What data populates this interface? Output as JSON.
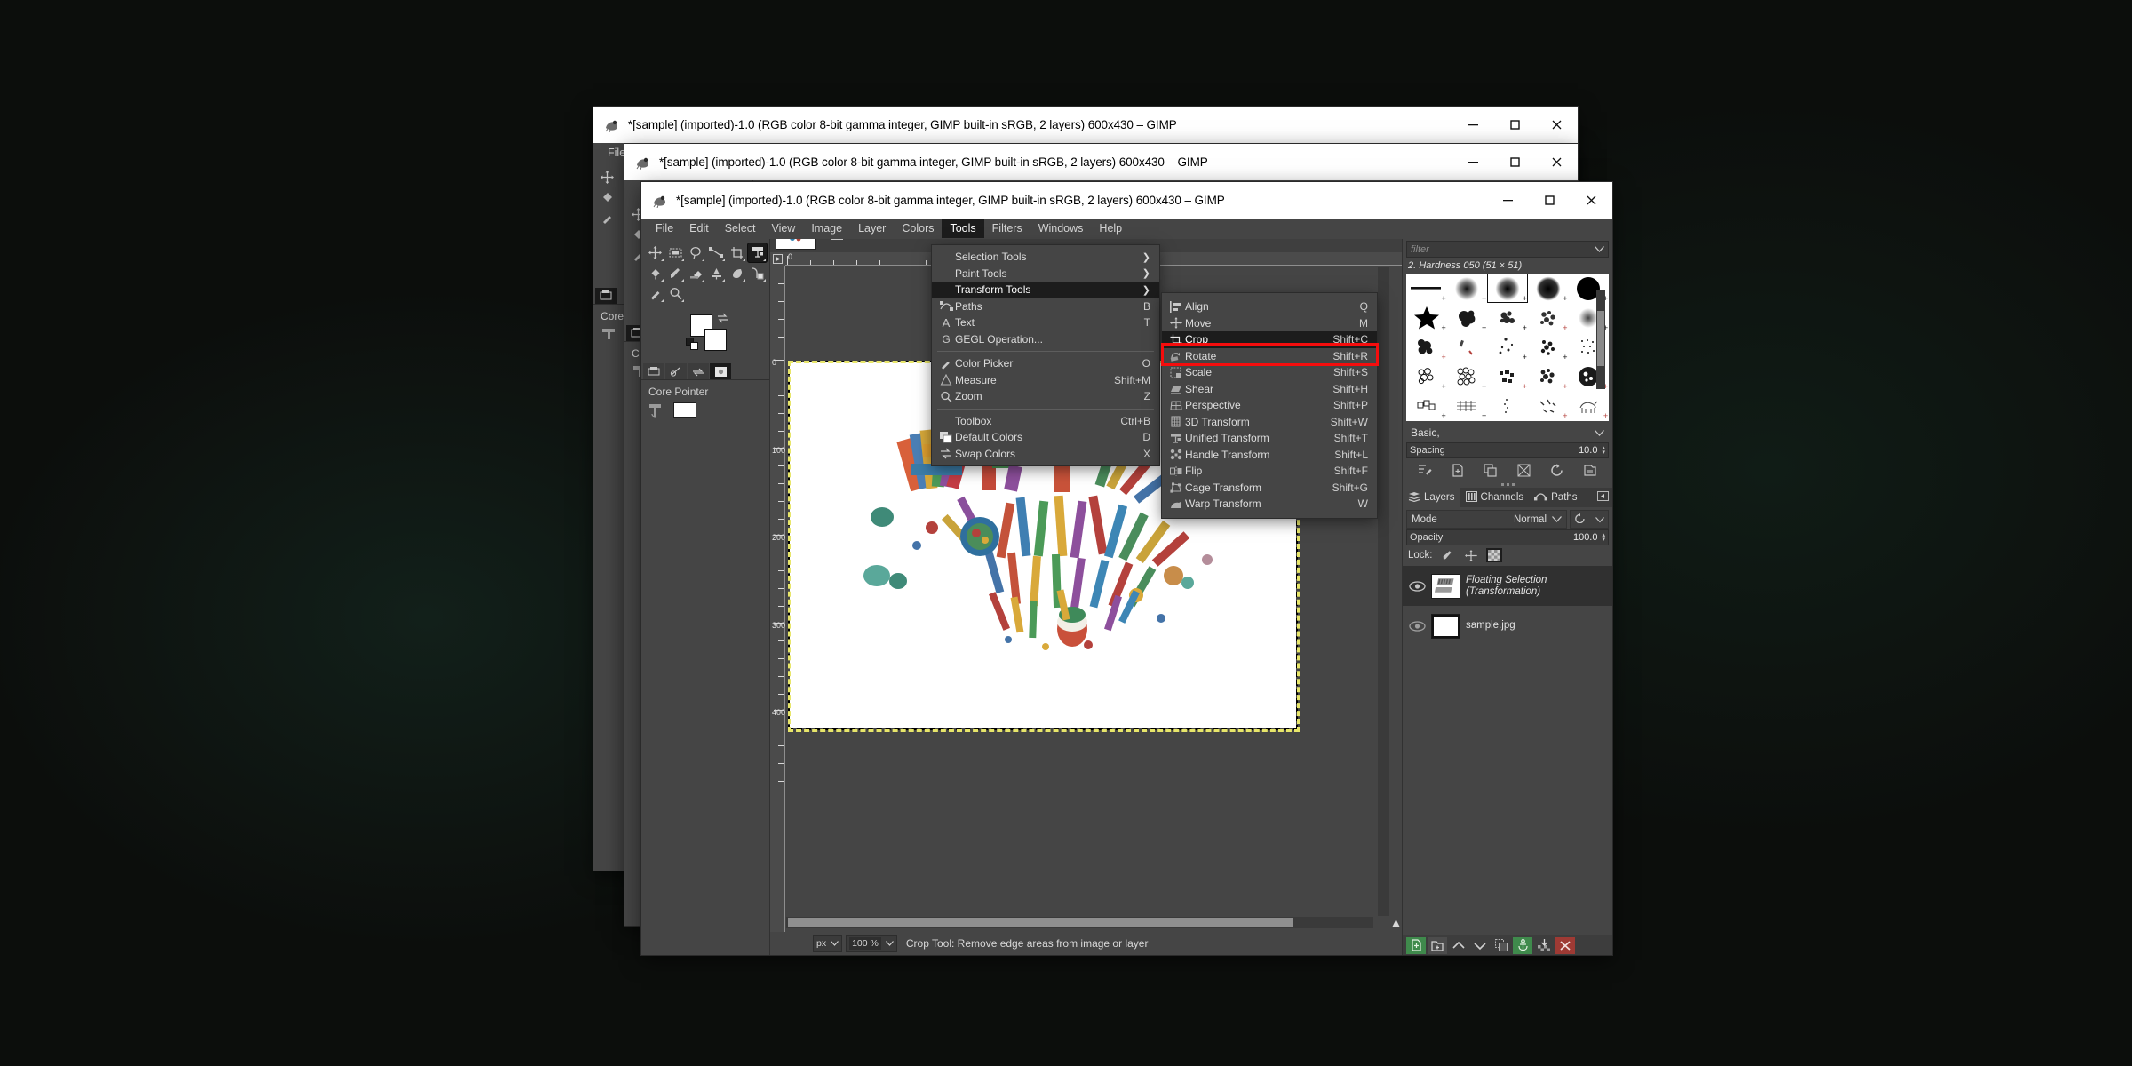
{
  "app": {
    "title": "*[sample] (imported)-1.0 (RGB color 8-bit gamma integer, GIMP built-in sRGB, 2 layers) 600x430 – GIMP",
    "window_count": 3,
    "accent_highlight": "#f50d0d",
    "desktop_bg": "#0c0e0c"
  },
  "titlebar": {
    "minimize": "–",
    "maximize": "□",
    "close": "✕",
    "icon": "gimp-wilber-icon"
  },
  "menubar": {
    "items": [
      {
        "label": "File",
        "active": false
      },
      {
        "label": "Edit",
        "active": false
      },
      {
        "label": "Select",
        "active": false
      },
      {
        "label": "View",
        "active": false
      },
      {
        "label": "Image",
        "active": false
      },
      {
        "label": "Layer",
        "active": false
      },
      {
        "label": "Colors",
        "active": false
      },
      {
        "label": "Tools",
        "active": true
      },
      {
        "label": "Filters",
        "active": false
      },
      {
        "label": "Windows",
        "active": false
      },
      {
        "label": "Help",
        "active": false
      }
    ]
  },
  "tools_menu": {
    "items": [
      {
        "label": "Selection Tools",
        "accel": "",
        "submenu": true,
        "icon": "",
        "selected": false
      },
      {
        "label": "Paint Tools",
        "accel": "",
        "submenu": true,
        "icon": "",
        "selected": false
      },
      {
        "label": "Transform Tools",
        "accel": "",
        "submenu": true,
        "icon": "",
        "selected": true
      },
      {
        "label": "Paths",
        "accel": "B",
        "submenu": false,
        "icon": "paths-icon",
        "selected": false
      },
      {
        "label": "Text",
        "accel": "T",
        "submenu": false,
        "icon": "text-icon",
        "selected": false
      },
      {
        "label": "GEGL Operation...",
        "accel": "",
        "submenu": false,
        "icon": "gegl-icon",
        "selected": false
      },
      {
        "separator": true
      },
      {
        "label": "Color Picker",
        "accel": "O",
        "submenu": false,
        "icon": "color-picker-icon",
        "selected": false
      },
      {
        "label": "Measure",
        "accel": "Shift+M",
        "submenu": false,
        "icon": "measure-icon",
        "selected": false
      },
      {
        "label": "Zoom",
        "accel": "Z",
        "submenu": false,
        "icon": "zoom-icon",
        "selected": false
      },
      {
        "separator": true
      },
      {
        "label": "Toolbox",
        "accel": "Ctrl+B",
        "submenu": false,
        "icon": "",
        "selected": false
      },
      {
        "label": "Default Colors",
        "accel": "D",
        "submenu": false,
        "icon": "default-colors-icon",
        "selected": false
      },
      {
        "label": "Swap Colors",
        "accel": "X",
        "submenu": false,
        "icon": "swap-colors-icon",
        "selected": false
      }
    ]
  },
  "transform_submenu": {
    "items": [
      {
        "label": "Align",
        "accel": "Q",
        "icon": "align-icon",
        "selected": false
      },
      {
        "label": "Move",
        "accel": "M",
        "icon": "move-icon",
        "selected": false
      },
      {
        "label": "Crop",
        "accel": "Shift+C",
        "icon": "crop-icon",
        "selected": true
      },
      {
        "label": "Rotate",
        "accel": "Shift+R",
        "icon": "rotate-icon",
        "selected": false
      },
      {
        "label": "Scale",
        "accel": "Shift+S",
        "icon": "scale-icon",
        "selected": false
      },
      {
        "label": "Shear",
        "accel": "Shift+H",
        "icon": "shear-icon",
        "selected": false
      },
      {
        "label": "Perspective",
        "accel": "Shift+P",
        "icon": "perspective-icon",
        "selected": false
      },
      {
        "label": "3D Transform",
        "accel": "Shift+W",
        "icon": "transform-3d-icon",
        "selected": false
      },
      {
        "label": "Unified Transform",
        "accel": "Shift+T",
        "icon": "unified-transform-icon",
        "selected": false
      },
      {
        "label": "Handle Transform",
        "accel": "Shift+L",
        "icon": "handle-transform-icon",
        "selected": false
      },
      {
        "label": "Flip",
        "accel": "Shift+F",
        "icon": "flip-icon",
        "selected": false
      },
      {
        "label": "Cage Transform",
        "accel": "Shift+G",
        "icon": "cage-transform-icon",
        "selected": false
      },
      {
        "label": "Warp Transform",
        "accel": "W",
        "icon": "warp-transform-icon",
        "selected": false
      }
    ]
  },
  "toolbox": {
    "tools": [
      {
        "name": "move-tool",
        "selected": false
      },
      {
        "name": "rectangle-select-tool",
        "selected": false
      },
      {
        "name": "free-select-tool",
        "selected": false
      },
      {
        "name": "paths-tool",
        "selected": false
      },
      {
        "name": "crop-tool",
        "selected": false
      },
      {
        "name": "unified-transform-tool",
        "selected": true
      },
      {
        "name": "bucket-fill-tool",
        "selected": false
      },
      {
        "name": "paintbrush-tool",
        "selected": false
      },
      {
        "name": "eraser-tool",
        "selected": false
      },
      {
        "name": "smudge-tool",
        "selected": false
      },
      {
        "name": "ink-tool",
        "selected": false
      },
      {
        "name": "clone-tool",
        "selected": false
      },
      {
        "name": "color-picker-tool",
        "selected": false
      },
      {
        "name": "zoom-tool",
        "selected": false
      }
    ],
    "foreground_color": "#ffffff",
    "background_color": "#ffffff",
    "device_status_label": "Core Pointer"
  },
  "canvas": {
    "image_name": "sample.jpg",
    "artwork_alt": "ART lettering collage of colorful art supplies",
    "ruler_h_labels": [
      "0"
    ],
    "ruler_v_labels": [
      "0",
      "100",
      "200",
      "300",
      "400"
    ],
    "selection_style": "yellow-black-dashed"
  },
  "statusbar": {
    "unit": "px",
    "zoom": "100 %",
    "message": "Crop Tool: Remove edge areas from image or layer"
  },
  "brushes_dock": {
    "tabs": [
      {
        "name": "brushes-tab",
        "selected": true
      },
      {
        "name": "gradients-tab",
        "selected": false
      },
      {
        "name": "fonts-tab",
        "selected": false
      },
      {
        "name": "document-history-tab",
        "selected": false
      }
    ],
    "filter_placeholder": "filter",
    "active_brush": "2. Hardness 050 (51 × 51)",
    "tag_selector": "Basic,",
    "spacing_label": "Spacing",
    "spacing_value": "10.0",
    "action_icons": [
      "edit-brush-icon",
      "new-brush-icon",
      "duplicate-brush-icon",
      "delete-brush-icon",
      "refresh-brushes-icon",
      "open-brush-folder-icon"
    ]
  },
  "layers_dock": {
    "tabs": [
      {
        "label": "Layers",
        "icon": "layers-icon",
        "selected": true
      },
      {
        "label": "Channels",
        "icon": "channels-icon",
        "selected": false
      },
      {
        "label": "Paths",
        "icon": "paths-icon",
        "selected": false
      }
    ],
    "mode_label": "Mode",
    "mode_value": "Normal",
    "opacity_label": "Opacity",
    "opacity_value": "100.0",
    "lock_label": "Lock:",
    "lock_items": [
      "lock-pixels-icon",
      "lock-position-icon",
      "lock-alpha-icon"
    ],
    "layers": [
      {
        "name": "Floating Selection",
        "name_line2": "(Transformation)",
        "italic": true,
        "visible": true,
        "selected": true,
        "thumb": "transform-thumb"
      },
      {
        "name": "sample.jpg",
        "name_line2": "",
        "italic": false,
        "visible": true,
        "selected": false,
        "thumb": "white-thumb"
      }
    ],
    "toolbar_buttons": [
      {
        "name": "new-layer-button",
        "style": "green"
      },
      {
        "name": "new-layer-group-button",
        "style": "grey"
      },
      {
        "name": "raise-layer-button",
        "style": "plain"
      },
      {
        "name": "lower-layer-button",
        "style": "plain"
      },
      {
        "name": "duplicate-layer-button",
        "style": "plain"
      },
      {
        "name": "anchor-layer-button",
        "style": "green"
      },
      {
        "name": "merge-down-button",
        "style": "plain"
      },
      {
        "name": "delete-layer-button",
        "style": "red"
      }
    ]
  }
}
